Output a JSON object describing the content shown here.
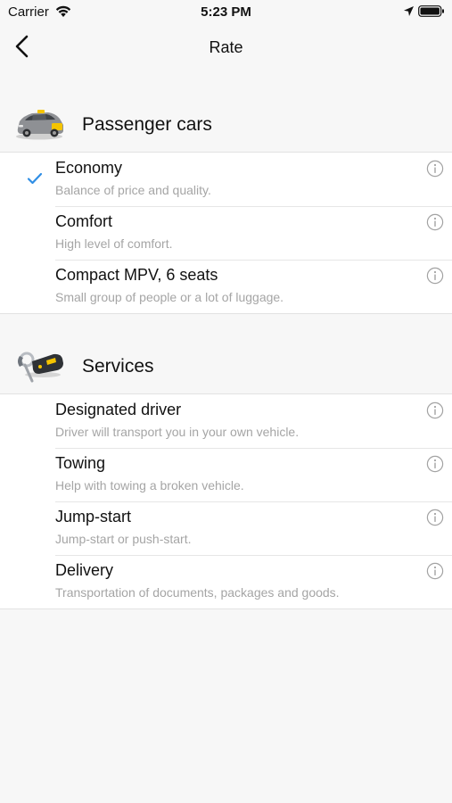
{
  "status_bar": {
    "carrier": "Carrier",
    "time": "5:23 PM"
  },
  "nav": {
    "title": "Rate"
  },
  "sections": [
    {
      "title": "Passenger cars",
      "icon": "taxi-car-icon",
      "items": [
        {
          "title": "Economy",
          "subtitle": "Balance of price and quality.",
          "selected": true
        },
        {
          "title": "Comfort",
          "subtitle": "High level of comfort.",
          "selected": false
        },
        {
          "title": "Compact MPV, 6 seats",
          "subtitle": "Small group of people or a lot of luggage.",
          "selected": false
        }
      ]
    },
    {
      "title": "Services",
      "icon": "car-keys-icon",
      "items": [
        {
          "title": "Designated driver",
          "subtitle": "Driver will transport you in your own vehicle."
        },
        {
          "title": "Towing",
          "subtitle": "Help with towing a broken vehicle."
        },
        {
          "title": "Jump-start",
          "subtitle": "Jump-start or push-start."
        },
        {
          "title": "Delivery",
          "subtitle": "Transportation of documents, packages and goods."
        }
      ]
    }
  ],
  "colors": {
    "accent": "#2f8ee5",
    "background": "#f7f7f7",
    "subtitle": "#a5a5a5",
    "taxi_yellow": "#f5c400"
  }
}
